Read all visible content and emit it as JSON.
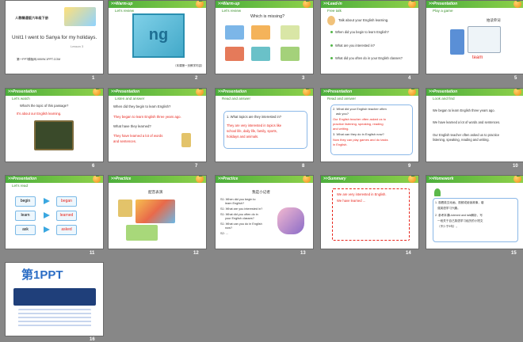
{
  "slides": [
    {
      "num": "1",
      "bar": "",
      "lines": [
        "人教精通版六年级下册",
        "Unit1 I went to Sanya for my holidays.",
        "Lesson 3",
        "第一PPT模板网-WWW.1PPT.COM"
      ]
    },
    {
      "num": "2",
      "bar": ">>Warm-up",
      "lines": [
        "Let's review",
        "ng",
        "（本课第一页教学内容）"
      ]
    },
    {
      "num": "3",
      "bar": ">>Warm-up",
      "lines": [
        "Let's review",
        "Which is missing?"
      ]
    },
    {
      "num": "4",
      "bar": ">>Lead-in",
      "lines": [
        "Free talk",
        "Talk about your English learning.",
        "When did you begin to learn English?",
        "What are you interested in?",
        "What did you often do in your English classes?"
      ]
    },
    {
      "num": "5",
      "bar": ">>Presentation",
      "lines": [
        "Play a game",
        "拍读单词",
        "team"
      ]
    },
    {
      "num": "6",
      "bar": ">>Presentation",
      "lines": [
        "Let's watch",
        "What's the topic of this passage?",
        "It's about our English learning."
      ]
    },
    {
      "num": "7",
      "bar": ">>Presentation",
      "lines": [
        "Listen and answer",
        "When did they begin to learn English?",
        "They began to learn English three years ago.",
        "What have they learned?",
        "They have learned a lot of words",
        "and sentences."
      ]
    },
    {
      "num": "8",
      "bar": ">>Presentation",
      "lines": [
        "Read and answer",
        "1. What topics are they interested in?",
        "They are very interested in topics like",
        "school life, daily life, family, sports,",
        "holidays and animals."
      ]
    },
    {
      "num": "9",
      "bar": ">>Presentation",
      "lines": [
        "Read and answer",
        "2. What did your English teacher often",
        "ask you?",
        "Our English teacher often asked us to",
        "practice listening, speaking, reading",
        "and writing.",
        "3. What can they do in English now?",
        "Now they can play games and do tasks",
        "in English."
      ]
    },
    {
      "num": "10",
      "bar": ">>Presentation",
      "lines": [
        "Look and find",
        "We began to learn English three years ago.",
        "We have learned a lot of words and sentences.",
        "Our English teacher often asked us to practice",
        "listening, speaking, reading and writing."
      ]
    },
    {
      "num": "11",
      "bar": ">>Presentation",
      "lines": [
        "Let's read",
        "begin",
        "began",
        "learn",
        "learned",
        "ask",
        "asked"
      ]
    },
    {
      "num": "12",
      "bar": ">>Practice",
      "lines": [
        "配音表演"
      ]
    },
    {
      "num": "13",
      "bar": ">>Practice",
      "lines": [
        "我是小记者",
        "S1: When did you begin to",
        "learn English?",
        "S1: What are you interested in?",
        "S1: What did you often do in",
        "your English classes?",
        "S1: What can you do in English",
        "now?",
        "S2: ..."
      ]
    },
    {
      "num": "14",
      "bar": ">>Summary",
      "lines": [
        "We are very interested in English.",
        "We have learned ..."
      ]
    },
    {
      "num": "15",
      "bar": ">>Homework",
      "lines": [
        "1. 观看英文动画、视频或阅读故事，增",
        "强英语学习兴趣。",
        "2. 参考本课Listened and talk解析，写",
        "一段关于自己英语学习经历的小短文",
        "（不少于5句）。"
      ]
    },
    {
      "num": "16",
      "bar": "",
      "lines": [
        "第1PPT"
      ]
    }
  ]
}
